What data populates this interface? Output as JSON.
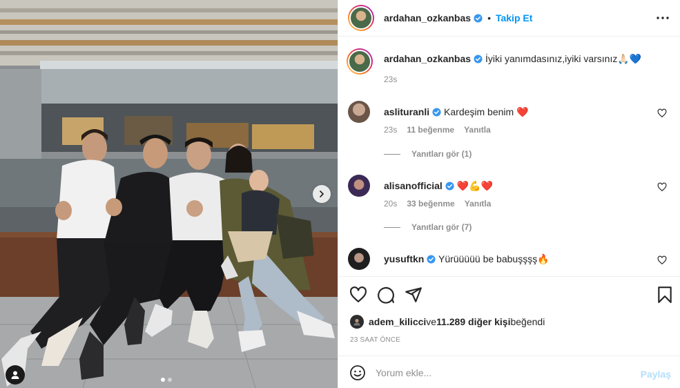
{
  "post": {
    "author": "ardahan_ozkanbas",
    "follow_label": "Takip Et",
    "sep": "•",
    "caption": "İyiki yanımdasınız,iyiki varsınız🙏🏻💙",
    "caption_time": "23s"
  },
  "comments": [
    {
      "user": "aslituranli",
      "text": "Kardeşim benim ❤️",
      "time": "23s",
      "likes": "11 beğenme",
      "reply": "Yanıtla",
      "replies_label": "Yanıtları gör (1)"
    },
    {
      "user": "alisanofficial",
      "text": "❤️💪❤️",
      "time": "20s",
      "likes": "33 beğenme",
      "reply": "Yanıtla",
      "replies_label": "Yanıtları gör (7)"
    },
    {
      "user": "yusuftkn",
      "text": "Yürüüüüü be babuşşşş🔥"
    }
  ],
  "likes": {
    "user": "adem_kilicci",
    "middle": " ve ",
    "others": "11.289 diğer kişi",
    "suffix": " beğendi"
  },
  "time_ago": "23 SAAT ÖNCE",
  "comment_box": {
    "placeholder": "Yorum ekle...",
    "share_label": "Paylaş"
  },
  "carousel": {
    "slides": 2,
    "active": 1
  },
  "colors": {
    "accent": "#0095f6",
    "verified": "#3897f0",
    "heart": "#ed4956",
    "share_disabled": "#b2dffc"
  },
  "icons": [
    "chevron-right-icon",
    "user-tag-icon",
    "more-icon",
    "verified-icon",
    "heart-icon",
    "comment-icon",
    "share-icon",
    "bookmark-icon",
    "emoji-icon"
  ]
}
